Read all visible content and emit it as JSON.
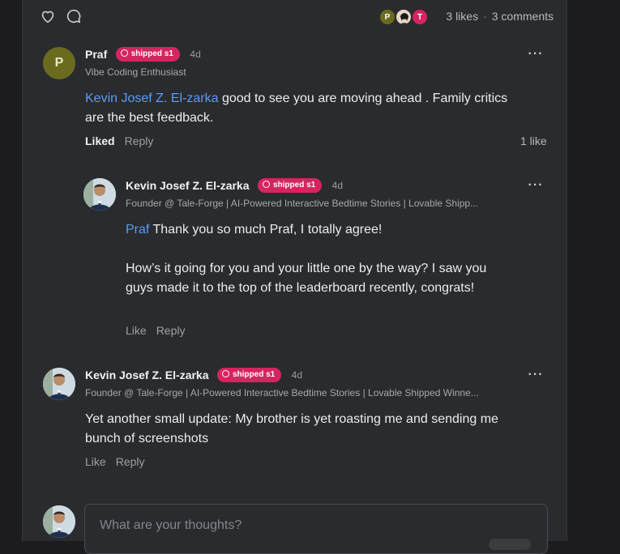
{
  "toolbar": {
    "likes_label": "3 likes",
    "comments_label": "3 comments",
    "liker_avatars": [
      {
        "letter": "P",
        "color": "#6b6b1f"
      },
      {
        "letter": "",
        "color": "#8a5a3c"
      },
      {
        "letter": "T",
        "color": "#d6245f"
      }
    ]
  },
  "comments": [
    {
      "avatar_letter": "P",
      "author": "Praf",
      "badge": "shipped s1",
      "time": "4d",
      "subtitle": "Vibe Coding Enthusiast",
      "mention": "Kevin Josef Z. El-zarka",
      "text": " good to see you are moving ahead . Family critics are the best feedback.",
      "like_action": "Liked",
      "reply_action": "Reply",
      "like_count": "1 like"
    },
    {
      "author": "Kevin Josef Z. El-zarka",
      "badge": "shipped s1",
      "time": "4d",
      "subtitle": "Founder @ Tale-Forge | AI-Powered Interactive Bedtime Stories | Lovable Shipp...",
      "mention": "Praf",
      "text": " Thank you so much Praf, I totally agree!",
      "text2": "How’s it going for you and your little one by the way? I saw you guys made it to the top of the leaderboard recently, congrats!",
      "like_action": "Like",
      "reply_action": "Reply"
    },
    {
      "author": "Kevin Josef Z. El-zarka",
      "badge": "shipped s1",
      "time": "4d",
      "subtitle": "Founder @ Tale-Forge | AI-Powered Interactive Bedtime Stories | Lovable Shipped Winne...",
      "text": "Yet another small update: My brother is yet roasting me and sending me bunch of screenshots",
      "like_action": "Like",
      "reply_action": "Reply"
    }
  ],
  "composer": {
    "placeholder": "What are your thoughts?"
  },
  "icons": {
    "like": "heart-icon",
    "comment": "speech-bubble-icon",
    "more": "more-horizontal-icon",
    "badge": "shipped-badge-icon"
  },
  "colors": {
    "background": "#2a2b2e",
    "badge": "#d6245f",
    "mention": "#5b9cf6"
  }
}
